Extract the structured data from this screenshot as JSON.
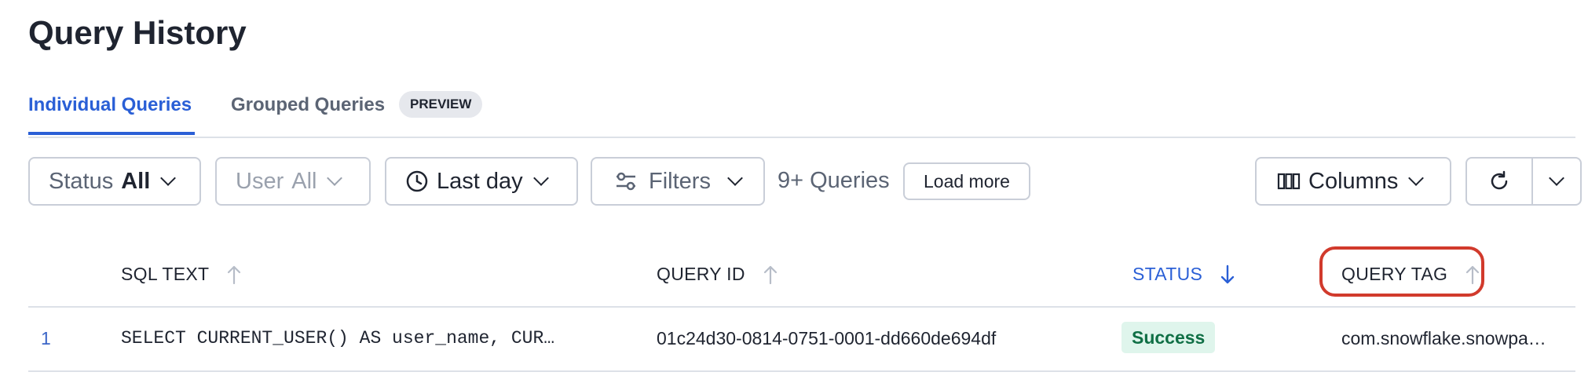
{
  "page": {
    "title": "Query History"
  },
  "tabs": [
    {
      "label": "Individual Queries",
      "active": true
    },
    {
      "label": "Grouped Queries",
      "badge": "PREVIEW",
      "active": false
    }
  ],
  "toolbar": {
    "status": {
      "label": "Status",
      "value": "All"
    },
    "user": {
      "label": "User",
      "value": "All"
    },
    "time": {
      "label": "Last day"
    },
    "filters": {
      "label": "Filters"
    },
    "count": "9+ Queries",
    "load_more": "Load more",
    "columns": "Columns"
  },
  "table": {
    "columns": [
      {
        "label": "SQL TEXT",
        "sort": "asc"
      },
      {
        "label": "QUERY ID",
        "sort": "asc"
      },
      {
        "label": "STATUS",
        "sort": "desc"
      },
      {
        "label": "QUERY TAG",
        "sort": "asc"
      }
    ],
    "rows": [
      {
        "index": "1",
        "sql_text": "SELECT CURRENT_USER() AS user_name, CUR…",
        "query_id": "01c24d30-0814-0751-0001-dd660de694df",
        "status": "Success",
        "query_tag": "com.snowflake.snowpa…"
      }
    ]
  },
  "colors": {
    "accent": "#2a5fd6",
    "success_bg": "#dff5ec",
    "success_text": "#0f6f45",
    "highlight": "#d13a2c"
  }
}
